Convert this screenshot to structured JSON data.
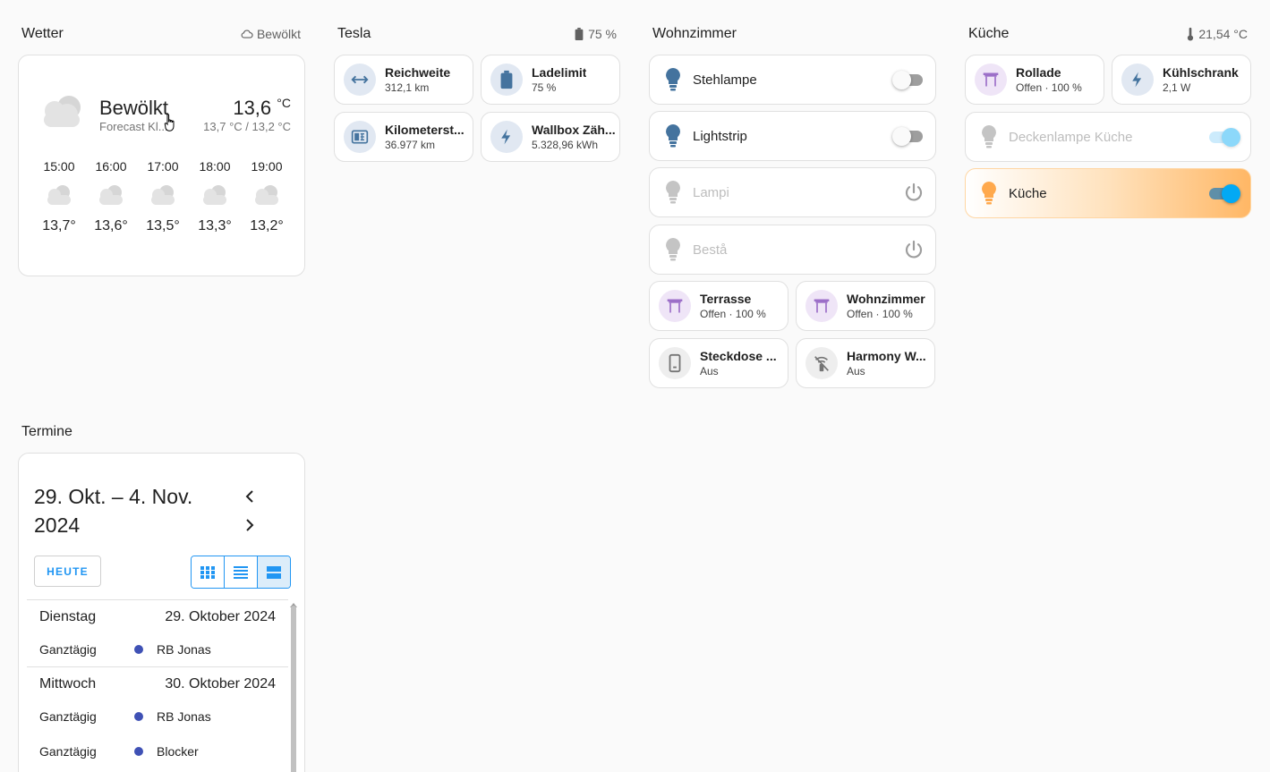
{
  "weather": {
    "title": "Wetter",
    "badge": "Bewölkt",
    "condition": "Bewölkt",
    "subtitle": "Forecast Kl...",
    "temp": "13,6",
    "temp_unit": "°C",
    "range": "13,7 °C / 13,2 °C",
    "forecast": [
      {
        "time": "15:00",
        "temp": "13,7°"
      },
      {
        "time": "16:00",
        "temp": "13,6°"
      },
      {
        "time": "17:00",
        "temp": "13,5°"
      },
      {
        "time": "18:00",
        "temp": "13,3°"
      },
      {
        "time": "19:00",
        "temp": "13,2°"
      }
    ]
  },
  "tesla": {
    "title": "Tesla",
    "badge": "75 %",
    "tiles": [
      {
        "name": "Reichweite",
        "state": "312,1 km"
      },
      {
        "name": "Ladelimit",
        "state": "75 %"
      },
      {
        "name": "Kilometerst...",
        "state": "36.977 km"
      },
      {
        "name": "Wallbox Zäh...",
        "state": "5.328,96 kWh"
      }
    ]
  },
  "wohnzimmer": {
    "title": "Wohnzimmer",
    "lights": [
      {
        "name": "Stehlampe"
      },
      {
        "name": "Lightstrip"
      },
      {
        "name": "Lampi"
      },
      {
        "name": "Bestå"
      }
    ],
    "tiles": [
      {
        "name": "Terrasse",
        "state": "Offen · 100 %"
      },
      {
        "name": "Wohnzimmer",
        "state": "Offen · 100 %"
      },
      {
        "name": "Steckdose ...",
        "state": "Aus"
      },
      {
        "name": "Harmony W...",
        "state": "Aus"
      }
    ]
  },
  "kueche": {
    "title": "Küche",
    "badge": "21,54 °C",
    "tiles": [
      {
        "name": "Rollade",
        "state": "Offen · 100 %"
      },
      {
        "name": "Kühlschrank",
        "state": "2,1 W"
      }
    ],
    "lights": [
      {
        "name": "Deckenlampe Küche"
      },
      {
        "name": "Küche"
      }
    ],
    "accent": "#ffa94d"
  },
  "termine": {
    "title": "Termine",
    "range": "29. Okt. – 4. Nov. 2024",
    "today_label": "HEUTE",
    "days": [
      {
        "weekday": "Dienstag",
        "date": "29. Oktober 2024",
        "events": [
          {
            "time": "Ganztägig",
            "title": "RB Jonas"
          }
        ]
      },
      {
        "weekday": "Mittwoch",
        "date": "30. Oktober 2024",
        "events": [
          {
            "time": "Ganztägig",
            "title": "RB Jonas"
          },
          {
            "time": "Ganztägig",
            "title": "Blocker"
          }
        ]
      }
    ],
    "event_color": "#3f51b5"
  },
  "colors": {
    "primary": "#03a9f4",
    "icon_blue": "#44739e",
    "icon_purple": "#9c6fc8",
    "calendar_blue": "#2196f3"
  }
}
